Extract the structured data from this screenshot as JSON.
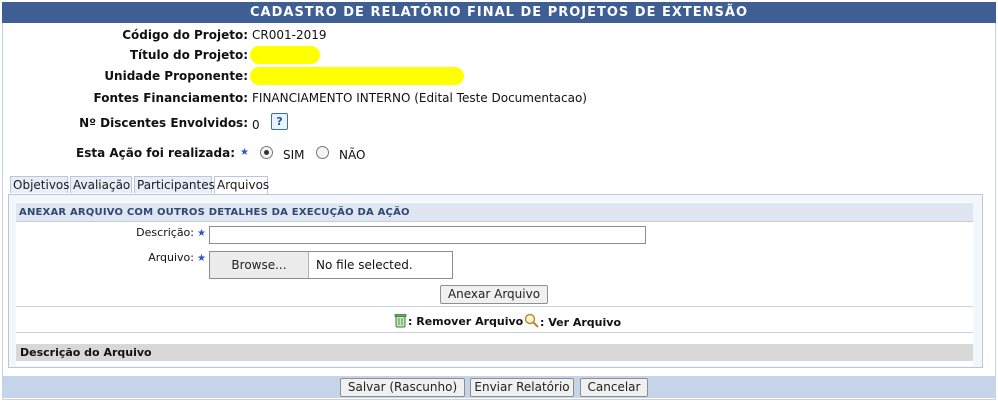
{
  "page_title": "CADASTRO DE RELATÓRIO FINAL DE PROJETOS DE EXTENSÃO",
  "project": {
    "codigo_label": "Código do Projeto:",
    "codigo_value": "CR001-2019",
    "titulo_label": "Título do Projeto:",
    "unidade_label": "Unidade Proponente:",
    "fontes_label": "Fontes Financiamento:",
    "fontes_value": "FINANCIAMENTO INTERNO (Edital Teste Documentacao)",
    "discentes_label": "Nº Discentes Envolvidos:",
    "discentes_value": "0",
    "help_glyph": "?",
    "acao_label": "Esta Ação foi realizada:",
    "required_mark": "★",
    "option_sim": "SIM",
    "option_nao": "NÃO",
    "selected_option": "SIM"
  },
  "tabs": [
    {
      "label": "Objetivos"
    },
    {
      "label": "Avaliação"
    },
    {
      "label": "Participantes"
    },
    {
      "label": "Arquivos"
    }
  ],
  "active_tab": "Arquivos",
  "attach": {
    "section_title": "ANEXAR ARQUIVO COM OUTROS DETALHES DA EXECUÇÃO DA AÇÃO",
    "descricao_label": "Descrição:",
    "descricao_value": "",
    "arquivo_label": "Arquivo:",
    "browse_label": "Browse...",
    "file_status": "No file selected.",
    "anexar_button": "Anexar Arquivo",
    "legend_remove": ": Remover Arquivo",
    "legend_view": ": Ver Arquivo",
    "list_header": "Descrição do Arquivo"
  },
  "footer": {
    "salvar_button": "Salvar (Rascunho)",
    "enviar_button": "Enviar Relatório",
    "cancelar_button": "Cancelar"
  },
  "colors": {
    "title_bar": "#3f5f94",
    "footer_bar": "#c6d4ea",
    "redaction": "#ffff00"
  },
  "icons": {
    "help": "help-icon",
    "remove": "trash-icon",
    "view": "magnifier-icon",
    "required": "star-icon"
  }
}
